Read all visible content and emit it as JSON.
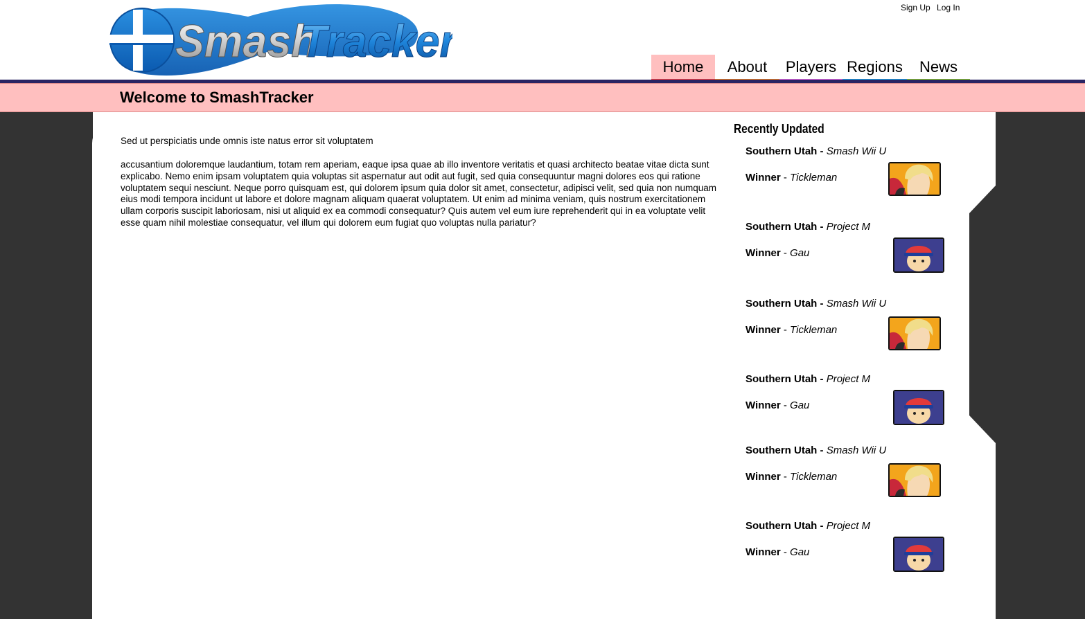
{
  "header": {
    "logo_text_1": "Smash",
    "logo_text_2": "Tracker",
    "auth": {
      "signup": "Sign Up",
      "login": "Log In"
    },
    "nav": [
      {
        "label": "Home",
        "color": "#ff4040",
        "active": true
      },
      {
        "label": "About",
        "color": "#f5841f"
      },
      {
        "label": "Players",
        "color": "#ee6ae8"
      },
      {
        "label": "Regions",
        "color": "#1ea6e8"
      },
      {
        "label": "News",
        "color": "#8fd12a"
      }
    ]
  },
  "welcome": {
    "title": "Welcome to SmashTracker"
  },
  "main": {
    "lede": "Sed ut perspiciatis unde omnis iste natus error sit voluptatem",
    "body": "accusantium doloremque laudantium, totam rem aperiam, eaque ipsa quae ab illo inventore veritatis et quasi architecto beatae vitae dicta sunt explicabo. Nemo enim ipsam voluptatem quia voluptas sit aspernatur aut odit aut fugit, sed quia consequuntur magni dolores eos qui ratione voluptatem sequi nesciunt. Neque porro quisquam est, qui dolorem ipsum quia dolor sit amet, consectetur, adipisci velit, sed quia non numquam eius modi tempora incidunt ut labore et dolore magnam aliquam quaerat voluptatem. Ut enim ad minima veniam, quis nostrum exercitationem ullam corporis suscipit laboriosam, nisi ut aliquid ex ea commodi consequatur? Quis autem vel eum iure reprehenderit qui in ea voluptate velit esse quam nihil molestiae consequatur, vel illum qui dolorem eum fugiat quo voluptas nulla pariatur?"
  },
  "sidebar": {
    "title": "Recently Updated",
    "entries": [
      {
        "region": "Southern Utah",
        "game": "Smash Wii U",
        "winner_label": "Winner",
        "winner": "Tickleman",
        "icon": "shulk-portrait-icon"
      },
      {
        "region": "Southern Utah",
        "game": "Project M",
        "winner_label": "Winner",
        "winner": "Gau",
        "icon": "ness-portrait-icon"
      },
      {
        "region": "Southern Utah",
        "game": "Smash Wii U",
        "winner_label": "Winner",
        "winner": "Tickleman",
        "icon": "shulk-portrait-icon"
      },
      {
        "region": "Southern Utah",
        "game": "Project M",
        "winner_label": "Winner",
        "winner": "Gau",
        "icon": "ness-portrait-icon"
      },
      {
        "region": "Southern Utah",
        "game": "Smash Wii U",
        "winner_label": "Winner",
        "winner": "Tickleman",
        "icon": "shulk-portrait-icon"
      },
      {
        "region": "Southern Utah",
        "game": "Project M",
        "winner_label": "Winner",
        "winner": "Gau",
        "icon": "ness-portrait-icon"
      }
    ]
  }
}
